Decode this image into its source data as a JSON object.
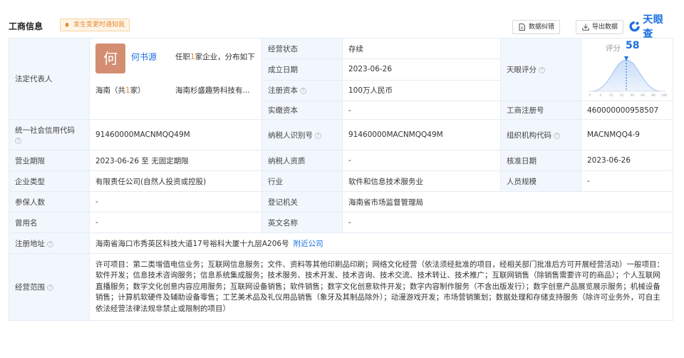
{
  "header": {
    "title": "工商信息",
    "notify_label": "发生变更时通知我",
    "fix_button": "数据纠错",
    "export_button": "导出数据",
    "logo_text": "天眼查",
    "brand_color": "#1a6fe0"
  },
  "rows": {
    "legal_rep": {
      "label": "法定代表人",
      "avatar_char": "何",
      "name": "何书源",
      "tenure_prefix": "任职",
      "tenure_count": "1",
      "tenure_suffix": "家企业，分布如下",
      "region_prefix": "海南（共",
      "region_count": "1",
      "region_suffix": "家）",
      "company": "海南杉盛趣势科技有..."
    },
    "status": {
      "label": "经营状态",
      "value": "存续"
    },
    "founded": {
      "label": "成立日期",
      "value": "2023-06-26"
    },
    "reg_capital": {
      "label": "注册资本",
      "value": "100万人民币"
    },
    "paid_capital": {
      "label": "实缴资本",
      "value": "-"
    },
    "tianyan_score": {
      "label": "天眼评分",
      "score_label": "评分",
      "score": "58",
      "axis_ticks": [
        "0",
        "2",
        "15",
        "31",
        "50",
        "66",
        "86",
        "100"
      ]
    },
    "reg_number": {
      "label": "工商注册号",
      "value": "460000000958507"
    },
    "credit_code": {
      "label": "统一社会信用代码",
      "value": "91460000MACNMQQ49M"
    },
    "taxpayer_id": {
      "label": "纳税人识别号",
      "value": "91460000MACNMQQ49M"
    },
    "org_code": {
      "label": "组织机构代码",
      "value": "MACNMQQ4-9"
    },
    "term": {
      "label": "营业期限",
      "value": "2023-06-26 至 无固定期限"
    },
    "taxpayer_qual": {
      "label": "纳税人资质",
      "value": "-"
    },
    "approval_date": {
      "label": "核准日期",
      "value": "2023-06-26"
    },
    "company_type": {
      "label": "企业类型",
      "value": "有限责任公司(自然人投资或控股)"
    },
    "industry": {
      "label": "行业",
      "value": "软件和信息技术服务业"
    },
    "staff_size": {
      "label": "人员规模",
      "value": "-"
    },
    "insured": {
      "label": "参保人数",
      "value": "-"
    },
    "authority": {
      "label": "登记机关",
      "value": "海南省市场监督管理局"
    },
    "former_name": {
      "label": "曾用名",
      "value": "-"
    },
    "english_name": {
      "label": "英文名称",
      "value": "-"
    },
    "address": {
      "label": "注册地址",
      "value": "海南省海口市秀英区科技大道17号裕科大厦十九层A206号",
      "link": "附近公司"
    },
    "scope": {
      "label": "经营范围",
      "value": "许可项目：第二类增值电信业务；互联网信息服务；文件、资料等其他印刷品印刷；网络文化经营（依法须经批准的项目，经相关部门批准后方可开展经营活动）一般项目：软件开发；信息技术咨询服务；信息系统集成服务；技术服务、技术开发、技术咨询、技术交流、技术转让、技术推广；互联网销售（除销售需要许可的商品）；个人互联网直播服务；数字文化创意内容应用服务；互联网设备销售；软件销售；数字文化创意软件开发；数字内容制作服务（不含出版发行）；数字创意产品展览展示服务；机械设备销售；计算机软硬件及辅助设备零售；工艺美术品及礼仪用品销售（象牙及其制品除外）；动漫游戏开发；市场营销策划；数据处理和存储支持服务（除许可业务外，可自主依法经营法律法规非禁止或限制的项目）"
    }
  }
}
